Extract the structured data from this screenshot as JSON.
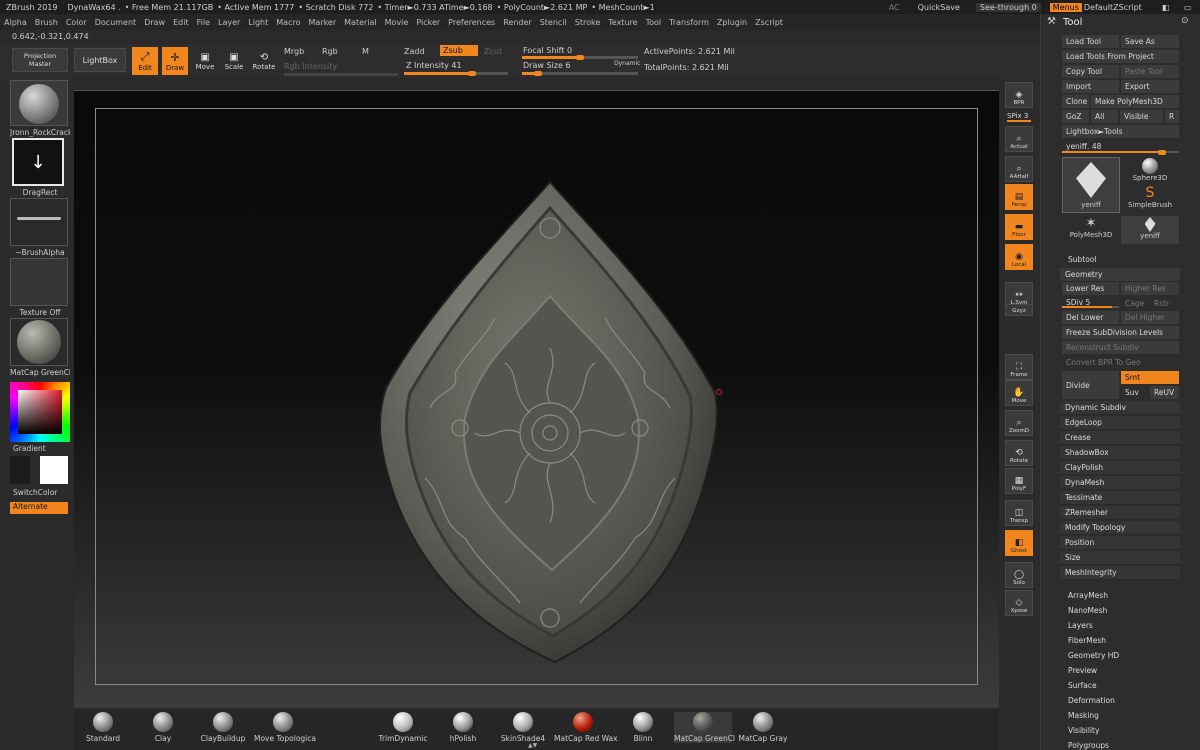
{
  "titlebar": {
    "app": "ZBrush 2019",
    "doc": "DynaWax64  .",
    "free_mem": "• Free Mem 21.117GB",
    "active_mem": "• Active Mem 1777",
    "scratch": "• Scratch Disk 772",
    "timer": "• Timer►0.733 ATime►0.168",
    "polycount": "• PolyCount►2.621 MP",
    "meshcount": "• MeshCount►1",
    "ac": "AC",
    "quicksave": "QuickSave",
    "see_through": "See-through  0",
    "menus": "Menus",
    "defaultzscript": "DefaultZScript"
  },
  "menubar": [
    "Alpha",
    "Brush",
    "Color",
    "Document",
    "Draw",
    "Edit",
    "File",
    "Layer",
    "Light",
    "Macro",
    "Marker",
    "Material",
    "Movie",
    "Picker",
    "Preferences",
    "Render",
    "Stencil",
    "Stroke",
    "Texture",
    "Tool",
    "Transform",
    "Zplugin",
    "Zscript"
  ],
  "coords": "0.642,-0.321,0.474",
  "toolbar": {
    "projection_master": "Projection Master",
    "lightbox": "LightBox",
    "edit": "Edit",
    "draw": "Draw",
    "move": "Move",
    "scale": "Scale",
    "rotate": "Rotate",
    "mrgb": "Mrgb",
    "rgb": "Rgb",
    "m": "M",
    "rgb_intensity": "Rgb Intensity",
    "zadd": "Zadd",
    "zsub": "Zsub",
    "zcut": "Zcut",
    "z_intensity": "Z Intensity 41",
    "focal_shift": "Focal Shift 0",
    "draw_size": "Draw Size 6",
    "dynamic": "Dynamic",
    "active_points": "ActivePoints: 2.621 Mil",
    "total_points": "TotalPoints: 2.621 Mil"
  },
  "left": {
    "brush": "Jronn_RockCrack",
    "stroke": "DragRect",
    "alpha": "~BrushAlpha",
    "texture": "Texture Off",
    "material": "MatCap GreenCl",
    "gradient": "Gradient",
    "switchcolor": "SwitchColor",
    "alternate": "Alternate"
  },
  "right_shelf": [
    "BPR",
    "SPix 3",
    "Actual",
    "AAHalf",
    "Persp",
    "Floor",
    "Local",
    "L.Sym",
    "Gxyz",
    "Frame",
    "Move",
    "ZoomD",
    "Rotate",
    "PolyF",
    "Transp",
    "Ghost",
    "Solo",
    "Xpose"
  ],
  "tool": {
    "title": "Tool",
    "load_tool": "Load Tool",
    "save_as": "Save As",
    "load_from_project": "Load Tools From Project",
    "copy_tool": "Copy Tool",
    "paste_tool": "Paste Tool",
    "import": "Import",
    "export": "Export",
    "clone": "Clone",
    "make_polymesh": "Make PolyMesh3D",
    "goz": "GoZ",
    "all": "All",
    "visible": "Visible",
    "r": "R",
    "lightbox_tools": "Lightbox►Tools",
    "yeniff_slider": "yeniff. 48",
    "thumbs": [
      "yeniff",
      "Sphere3D",
      "SimpleBrush",
      "PolyMesh3D",
      "yeniff"
    ],
    "subtool": "Subtool",
    "geometry": "Geometry",
    "lower_res": "Lower Res",
    "higher_res": "Higher Res",
    "sdiv": "SDiv 5",
    "cage": "Cage",
    "rstr": "Rstr",
    "del_lower": "Del Lower",
    "del_higher": "Del Higher",
    "freeze_subdiv": "Freeze SubDivision Levels",
    "reconstruct": "Reconstruct Subdiv",
    "convert_bpr": "Convert BPR To Geo",
    "divide": "Divide",
    "smt": "Smt",
    "suv": "Suv",
    "reuv": "ReUV",
    "geometry_items": [
      "Dynamic Subdiv",
      "EdgeLoop",
      "Crease",
      "ShadowBox",
      "ClayPolish",
      "DynaMesh",
      "Tessimate",
      "ZRemesher",
      "Modify Topology",
      "Position",
      "Size",
      "MeshIntegrity"
    ],
    "sections": [
      "ArrayMesh",
      "NanoMesh",
      "Layers",
      "FiberMesh",
      "Geometry HD",
      "Preview",
      "Surface",
      "Deformation",
      "Masking",
      "Visibility",
      "Polygroups"
    ]
  },
  "bottom_shelf": [
    "Standard",
    "Clay",
    "ClayBuildup",
    "Move Topologica",
    "TrimDynamic",
    "hPolish",
    "SkinShade4",
    "MatCap Red Wax",
    "Blinn",
    "MatCap GreenCl",
    "MatCap Gray"
  ]
}
